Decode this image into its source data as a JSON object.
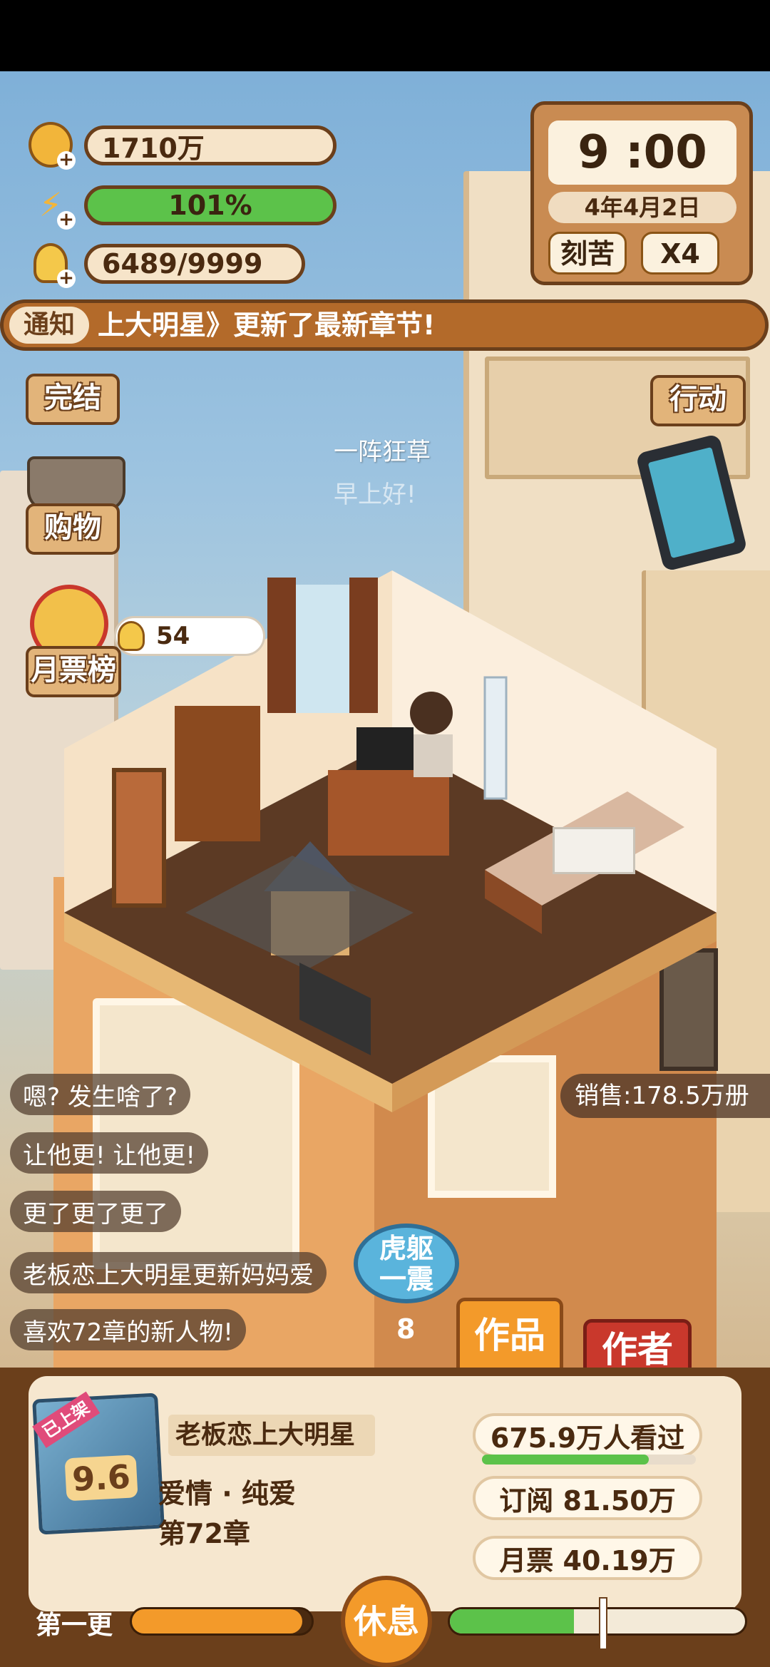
{
  "stats": {
    "coins": "1710万",
    "energy": "101%",
    "inspiration": "6489/9999"
  },
  "clock": {
    "time": "9 :00",
    "date": "4年4月2日",
    "mode_button": "刻苦",
    "speed_button": "X4"
  },
  "notice": {
    "label": "通知",
    "text": "上大明星》更新了最新章节!"
  },
  "side_left": {
    "finish": "完结",
    "shopping": "购物",
    "monthly_rank": "月票榜",
    "idea_count": "54"
  },
  "side_right": {
    "action": "行动"
  },
  "floating": {
    "line1": "一阵狂草",
    "line2": "早上好!"
  },
  "sales": "销售:178.5万册",
  "chats": [
    "嗯? 发生啥了?",
    "让他更! 让他更!",
    "更了更了更了",
    "老板恋上大明星更新妈妈爱",
    "喜欢72章的新人物!"
  ],
  "combo": {
    "label_top": "虎躯",
    "label_bottom": "一震",
    "count": "8"
  },
  "tabs": {
    "works": "作品",
    "author": "作者"
  },
  "book": {
    "badge": "已上架",
    "score": "9.6",
    "title": "老板恋上大明星",
    "genre": "爱情 · 纯爱",
    "chapter": "第72章",
    "readers": "675.9万人看过",
    "subscribe": "订阅 81.50万",
    "monthly_votes": "月票 40.19万",
    "readers_progress": 0.78
  },
  "bottom": {
    "update_label": "第一更",
    "rest_button": "休息",
    "update_progress": 0.95,
    "energy_progress": 0.42
  },
  "colors": {
    "brown": "#6b3f1b",
    "cream": "#f6e4c9",
    "green": "#5cc24a",
    "orange": "#f39a2a",
    "red": "#c9382c"
  }
}
